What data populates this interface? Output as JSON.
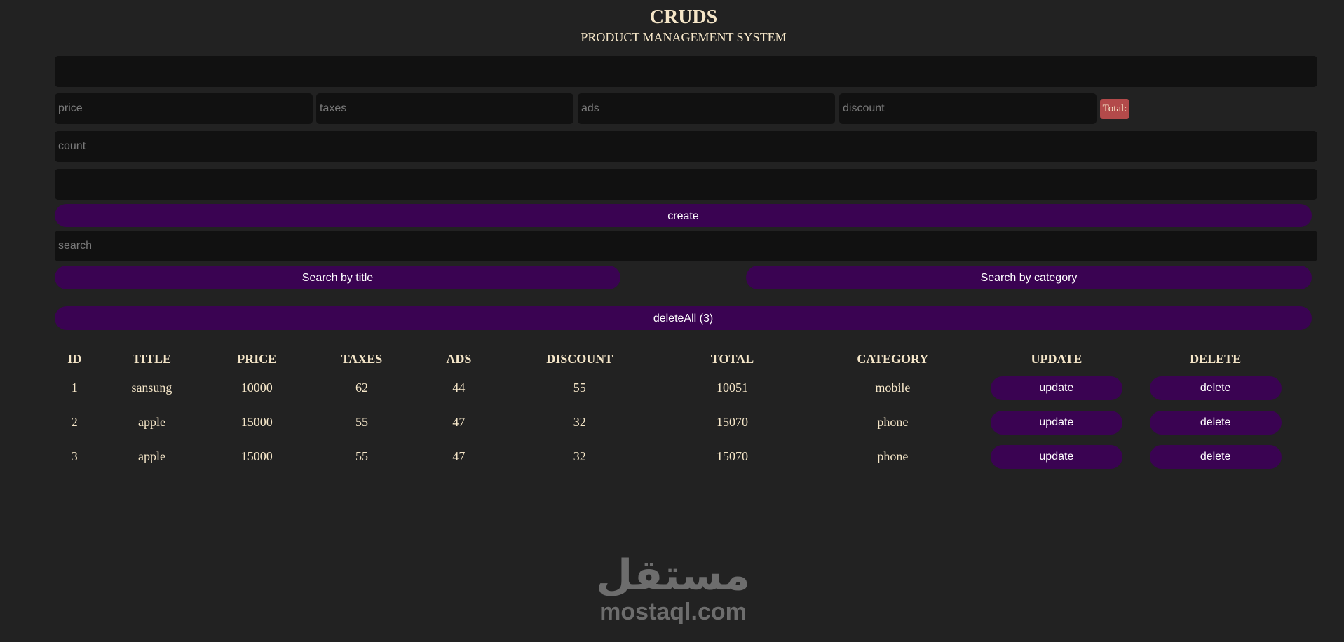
{
  "header": {
    "title": "CRUDS",
    "subtitle": "PRODUCT MANAGEMENT SYSTEM"
  },
  "form": {
    "title_placeholder": "",
    "price_placeholder": "price",
    "taxes_placeholder": "taxes",
    "ads_placeholder": "ads",
    "discount_placeholder": "discount",
    "total_label": "Total:",
    "count_placeholder": "count",
    "category_placeholder": "",
    "create_label": "create"
  },
  "search": {
    "placeholder": "search",
    "by_title_label": "Search by title",
    "by_category_label": "Search by category"
  },
  "delete_all_label": "deleteAll (3)",
  "table": {
    "headers": [
      "ID",
      "TITLE",
      "PRICE",
      "TAXES",
      "ADS",
      "DISCOUNT",
      "TOTAL",
      "CATEGORY",
      "UPDATE",
      "DELETE"
    ],
    "rows": [
      {
        "id": "1",
        "title": "sansung",
        "price": "10000",
        "taxes": "62",
        "ads": "44",
        "discount": "55",
        "total": "10051",
        "category": "mobile",
        "update": "update",
        "delete": "delete"
      },
      {
        "id": "2",
        "title": "apple",
        "price": "15000",
        "taxes": "55",
        "ads": "47",
        "discount": "32",
        "total": "15070",
        "category": "phone",
        "update": "update",
        "delete": "delete"
      },
      {
        "id": "3",
        "title": "apple",
        "price": "15000",
        "taxes": "55",
        "ads": "47",
        "discount": "32",
        "total": "15070",
        "category": "phone",
        "update": "update",
        "delete": "delete"
      }
    ]
  },
  "watermark": {
    "arabic": "مستقل",
    "latin": "mostaql.com"
  },
  "colors": {
    "background": "#222222",
    "input_background": "#111111",
    "button": "#3a0352",
    "total_badge": "#b34a4a",
    "text": "#f5e6c8"
  }
}
